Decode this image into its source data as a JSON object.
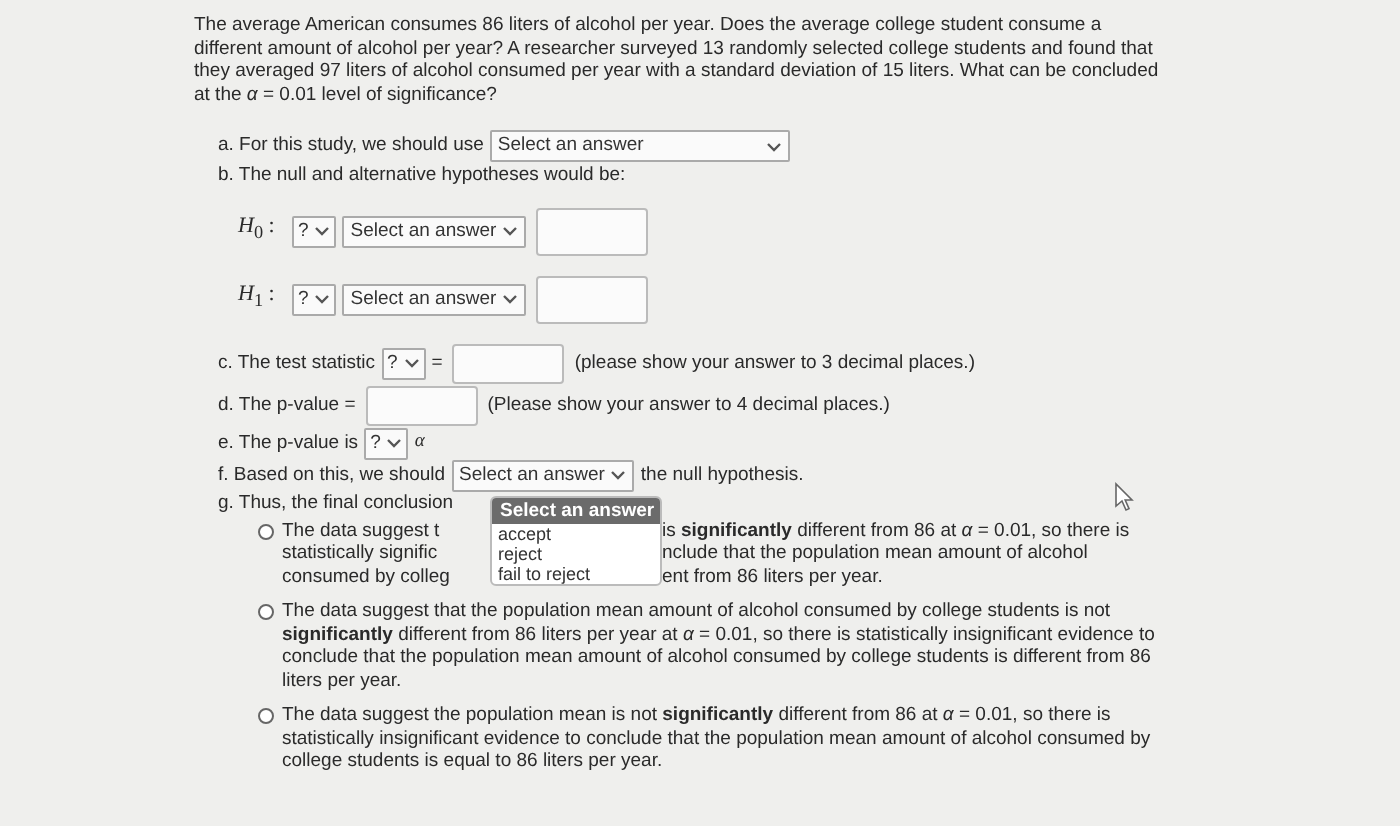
{
  "problem": "The average American consumes 86 liters of alcohol per year. Does the average college student consume a different amount of alcohol per year? A researcher surveyed 13 randomly selected college students and found that they averaged 97 liters of alcohol consumed per year with a standard deviation of 15 liters. What can be concluded at the *α* = 0.01 level of significance?",
  "part_a": {
    "label": "a. For this study, we should use",
    "dropdown": "Select an answer"
  },
  "part_b": {
    "label": "b. The null and alternative hypotheses would be:"
  },
  "hypotheses": [
    {
      "label": "*H*$_{0}$ :",
      "operator": "?",
      "dropdown": "Select an answer"
    },
    {
      "label": "*H*$_{1}$ :",
      "operator": "?",
      "dropdown": "Select an answer"
    }
  ],
  "part_c": {
    "label": "c. The test statistic",
    "operator": "?",
    "equals": "=",
    "note": "(please show your answer to 3 decimal places.)"
  },
  "part_d": {
    "label": "d. The p-value =",
    "note": "(Please show your answer to 4 decimal places.)"
  },
  "part_e": {
    "label": "e. The p-value is",
    "operator": "?",
    "symbol": "α"
  },
  "part_f": {
    "label": "f. Based on this, we should",
    "dropdown": "Select an answer",
    "after": "the null hypothesis."
  },
  "part_g": {
    "label": "g. Thus, the final conclusion",
    "menu": {
      "header": "Select an answer",
      "options": [
        "accept",
        "reject",
        "fail to reject"
      ]
    }
  },
  "conclusions": [
    {
      "kind": "obscured",
      "selected": false,
      "lines": [
        {
          "left": "The data suggest t",
          "right": "is **significantly** different from 86 at *α* = 0.01, so there is"
        },
        {
          "left": "statistically signific",
          "right": "nclude that the population mean amount of alcohol"
        },
        {
          "left": "consumed by colleg",
          "right": "ent from 86 liters per year."
        }
      ]
    },
    {
      "kind": "text",
      "selected": false,
      "text": "The data suggest that the population mean amount of alcohol consumed by college students is not **significantly** different from 86 liters per year at *α* = 0.01, so there is statistically insignificant evidence to conclude that the population mean amount of alcohol consumed by college students is different from 86 liters per year."
    },
    {
      "kind": "text",
      "selected": false,
      "text": "The data suggest the population mean is not **significantly** different from 86 at *α* = 0.01, so there is statistically insignificant evidence to conclude that the population mean amount of alcohol consumed by college students is equal to 86 liters per year."
    }
  ]
}
